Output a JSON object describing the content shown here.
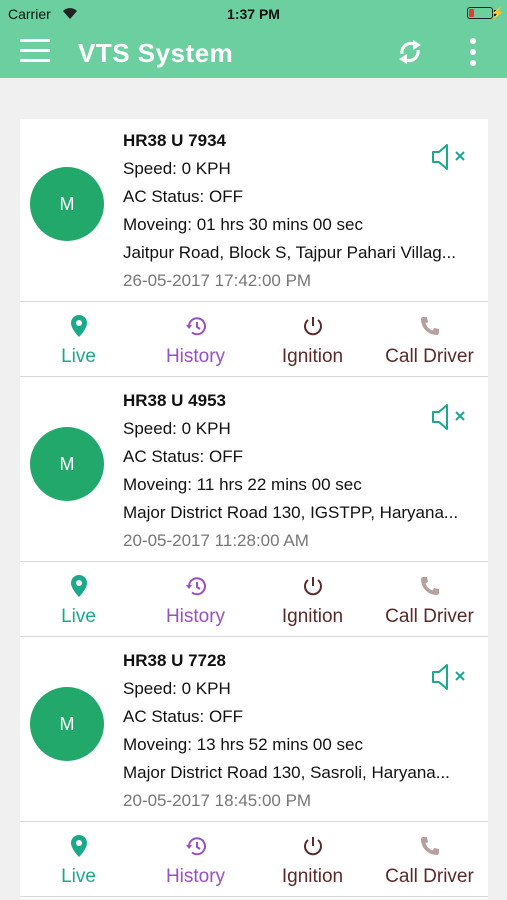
{
  "status_bar": {
    "carrier": "Carrier",
    "time": "1:37 PM",
    "battery_level": 0.15
  },
  "app_bar": {
    "title": "VTS System",
    "icons": [
      "menu-icon",
      "refresh-icon",
      "more-vert-icon"
    ]
  },
  "colors": {
    "primary": "#6bcf9f",
    "avatar": "#22a86b",
    "live": "#1aa98a",
    "history": "#9a4fc3",
    "ignition": "#5a2a2a",
    "call": "#5a2a2a"
  },
  "vehicles": [
    {
      "avatar": "M",
      "plate": "HR38 U 7934",
      "speed": "Speed: 0 KPH",
      "ac": "AC Status: OFF",
      "moving": "Moveing: 01 hrs 30 mins 00 sec",
      "address": "Jaitpur Road, Block S, Tajpur Pahari Villag...",
      "timestamp": "26-05-2017 17:42:00 PM"
    },
    {
      "avatar": "M",
      "plate": "HR38 U 4953",
      "speed": "Speed: 0 KPH",
      "ac": "AC Status: OFF",
      "moving": "Moveing: 11 hrs 22 mins 00 sec",
      "address": "Major District Road 130, IGSTPP, Haryana...",
      "timestamp": "20-05-2017 11:28:00 AM"
    },
    {
      "avatar": "M",
      "plate": "HR38 U 7728",
      "speed": "Speed: 0 KPH",
      "ac": "AC Status: OFF",
      "moving": "Moveing: 13 hrs 52 mins 00 sec",
      "address": "Major District Road 130, Sasroli, Haryana...",
      "timestamp": "20-05-2017 18:45:00 PM"
    }
  ],
  "actions": {
    "live": "Live",
    "history": "History",
    "ignition": "Ignition",
    "call": "Call Driver"
  }
}
